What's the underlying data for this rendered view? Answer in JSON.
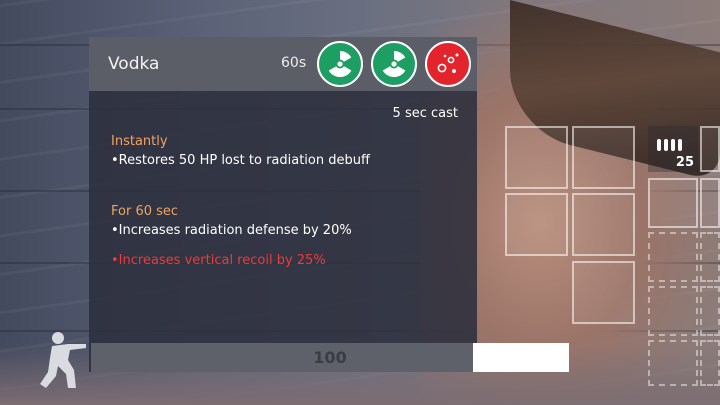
{
  "item": {
    "name": "Vodka",
    "duration": "60s",
    "cast_time": "5 sec cast",
    "effect_icons": [
      "radiation-icon",
      "radiation-icon",
      "bleeding-icon"
    ],
    "colors": {
      "positive": "#1d9f63",
      "negative": "#e4242d",
      "section": "#f0a360"
    }
  },
  "effects": {
    "instant": {
      "heading": "Instantly",
      "lines": [
        "•Restores 50 HP lost to radiation debuff"
      ]
    },
    "timed": {
      "heading": "For 60 sec",
      "lines": [
        "•Increases radiation defense by 20%"
      ],
      "negative_lines": [
        "•Increases vertical recoil by 25%"
      ]
    }
  },
  "use_bar": {
    "value": "100",
    "fill_fraction": 0.8
  },
  "hud": {
    "ammo_count": "25",
    "ammo_icon": "bullets-icon",
    "stance_icon": "crouch-stance-icon"
  }
}
